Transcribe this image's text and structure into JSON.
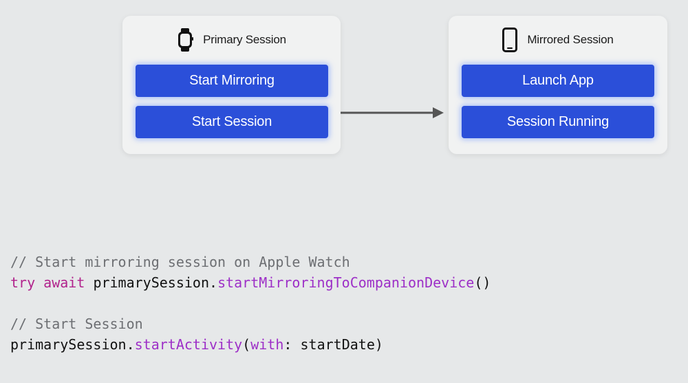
{
  "primary": {
    "title": "Primary Session",
    "icon": "apple-watch-icon",
    "buttons": [
      "Start Mirroring",
      "Start Session"
    ]
  },
  "mirrored": {
    "title": "Mirrored Session",
    "icon": "iphone-icon",
    "buttons": [
      "Launch App",
      "Session Running"
    ]
  },
  "code": {
    "comment1": "// Start mirroring session on Apple Watch",
    "line2": {
      "kw_try": "try",
      "kw_await": "await",
      "object": "primarySession",
      "dot": ".",
      "method": "startMirroringToCompanionDevice",
      "parens": "()"
    },
    "comment2": "// Start Session",
    "line4": {
      "object": "primarySession",
      "dot": ".",
      "method": "startActivity",
      "open": "(",
      "param": "with",
      "colon": ": ",
      "arg": "startDate",
      "close": ")"
    }
  },
  "colors": {
    "background": "#e6e8e9",
    "card": "#f1f2f2",
    "button": "#2b4fd9",
    "comment": "#6d6f73",
    "keyword": "#b1238c",
    "function": "#9d2fc7",
    "arrow": "#555555"
  }
}
